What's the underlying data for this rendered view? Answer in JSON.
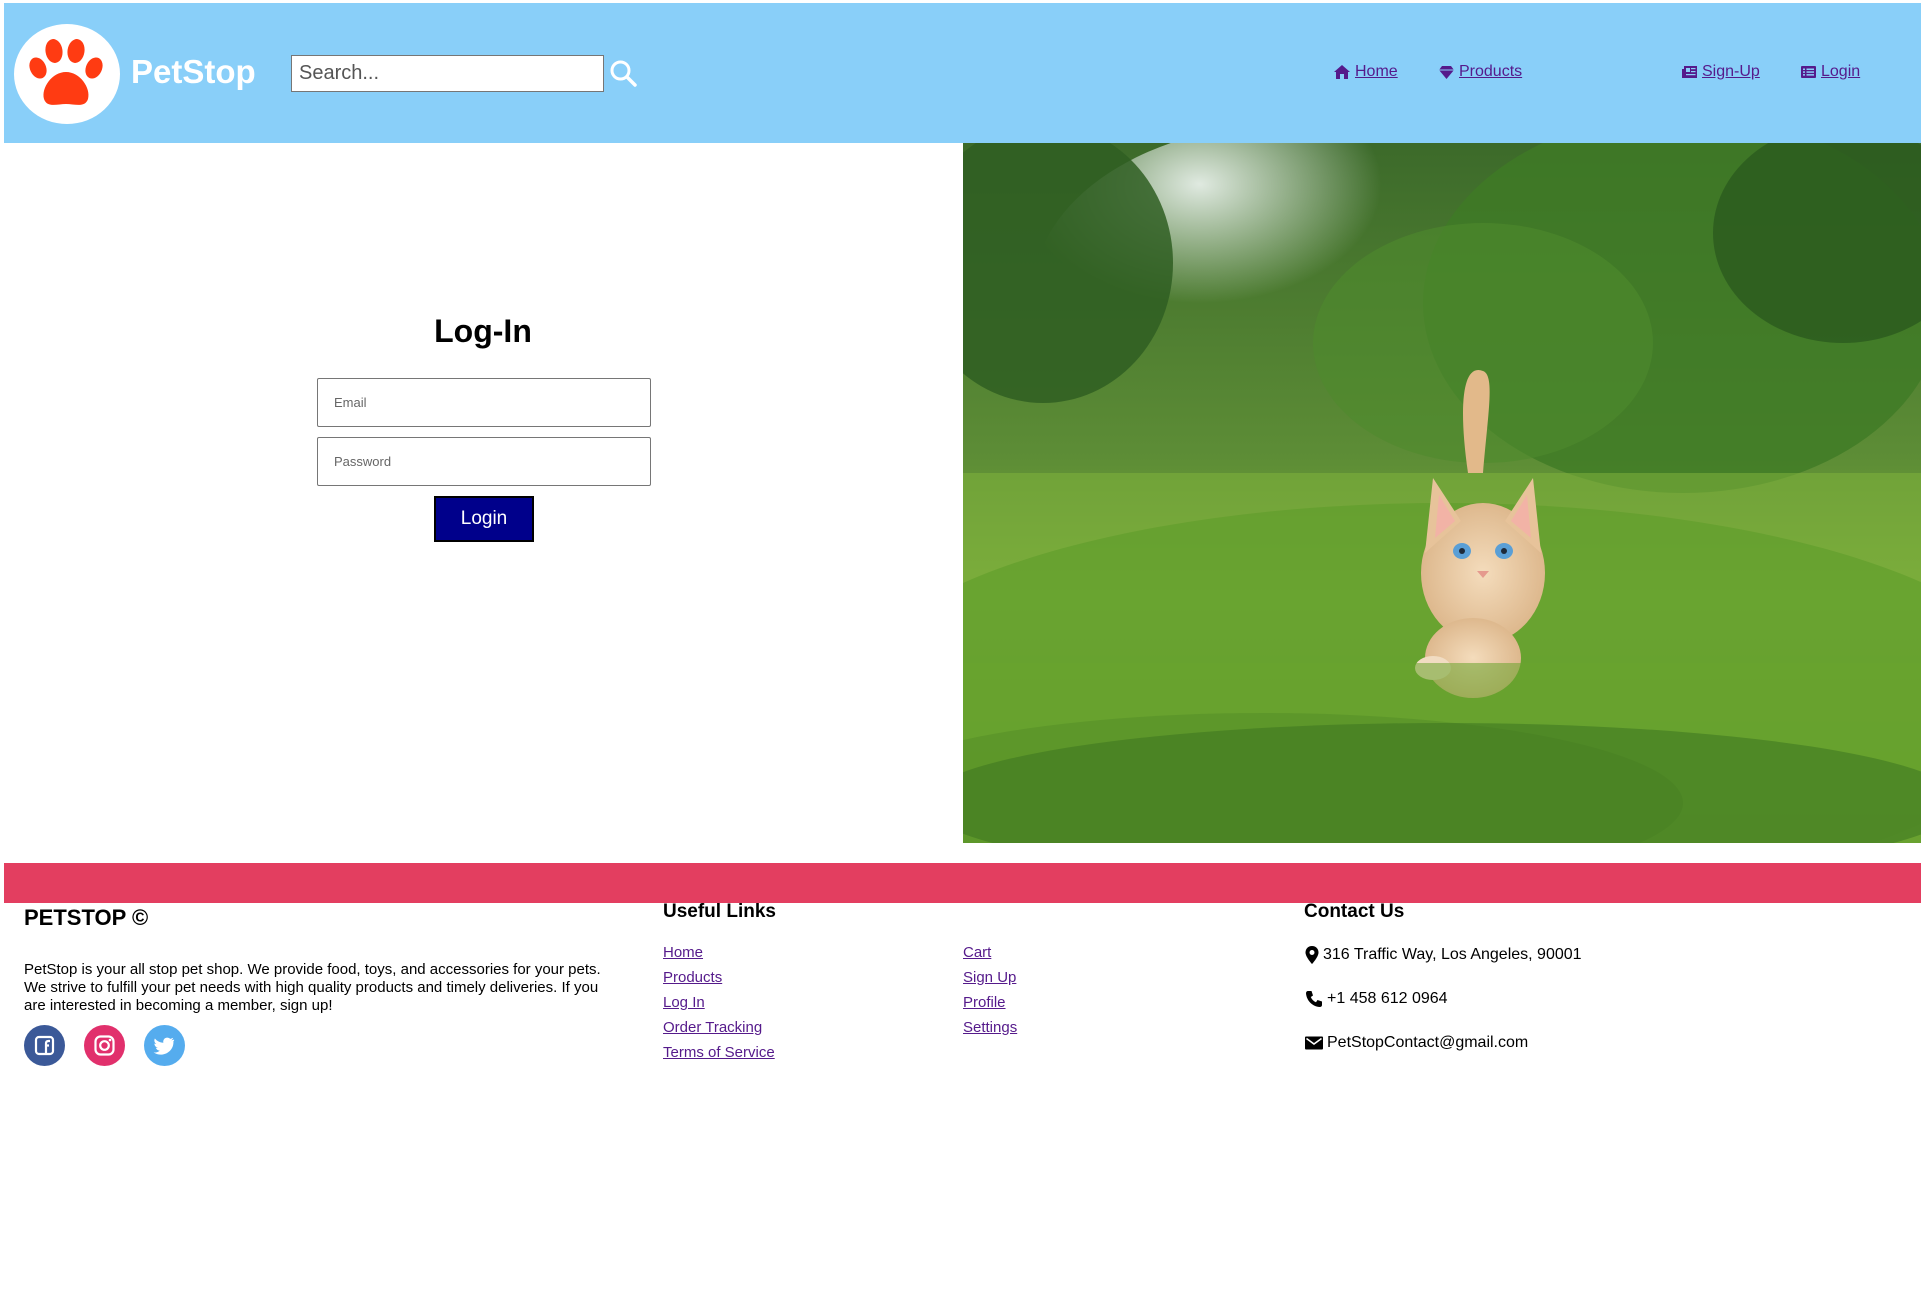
{
  "header": {
    "brand": "PetStop",
    "search_placeholder": "Search...",
    "nav": {
      "home": "Home",
      "products": "Products",
      "signup": "Sign-Up",
      "login": "Login"
    }
  },
  "login": {
    "title": "Log-In",
    "email_placeholder": "Email",
    "password_placeholder": "Password",
    "button": "Login"
  },
  "footer": {
    "brand_title": "PETSTOP ©",
    "about": "PetStop is your all stop pet shop. We provide food, toys, and accessories for your pets. We strive to fulfill your pet needs with high quality products and timely deliveries. If you are interested in becoming a member, sign up!",
    "useful_links_title": "Useful Links",
    "links_col1": [
      "Home",
      "Products",
      "Log In",
      "Order Tracking",
      "Terms of Service"
    ],
    "links_col2": [
      "Cart",
      "Sign Up",
      "Profile",
      "Settings"
    ],
    "contact_title": "Contact Us",
    "address": "316 Traffic Way, Los Angeles, 90001",
    "phone": "+1 458 612 0964",
    "email": "PetStopContact@gmail.com"
  },
  "icons": {
    "logo": "paw-icon",
    "search": "search-icon",
    "home": "home-icon",
    "products": "gem-icon",
    "signup": "newspaper-icon",
    "login": "list-icon",
    "facebook": "facebook-icon",
    "instagram": "instagram-icon",
    "twitter": "twitter-icon",
    "address": "map-pin-icon",
    "phone": "phone-icon",
    "email": "mail-icon"
  },
  "colors": {
    "header_bg": "#89cff9",
    "paw": "#ff3b12",
    "login_button": "#00008b",
    "footer_bar": "#e33e60",
    "link": "#551a8b",
    "facebook": "#3b5998",
    "instagram": "#e1306c",
    "twitter": "#55acee"
  }
}
